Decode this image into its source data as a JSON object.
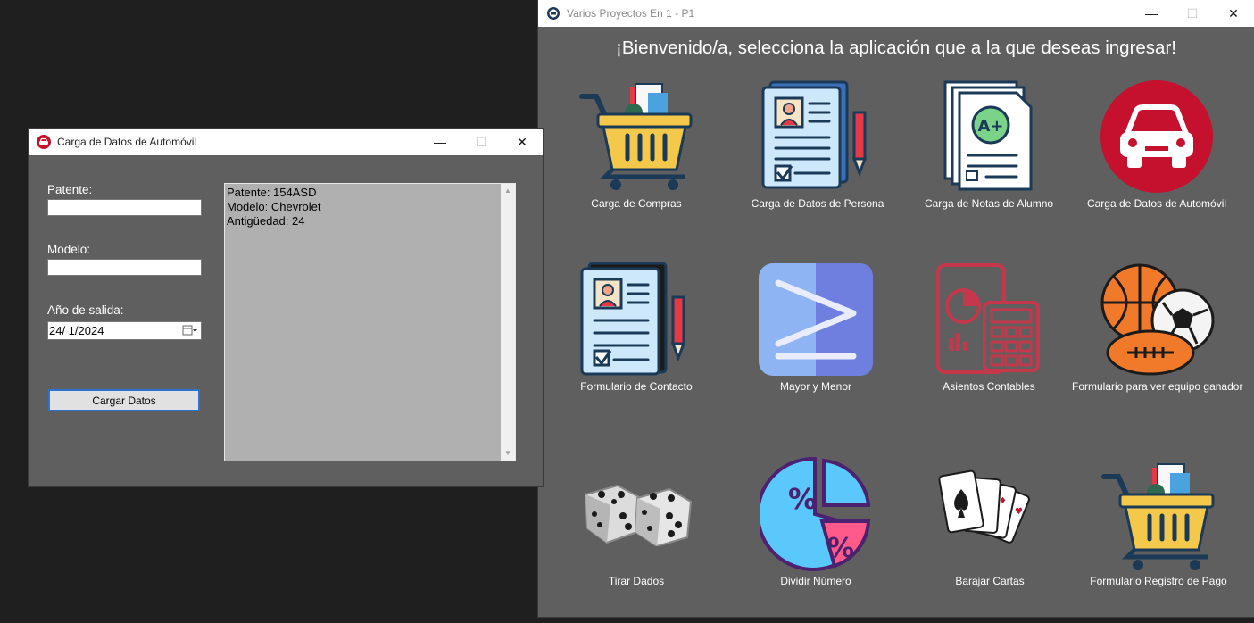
{
  "main_window": {
    "title": "Varios Proyectos En 1 - P1",
    "welcome": "¡Bienvenido/a, selecciona la aplicación que a la que deseas ingresar!",
    "controls": {
      "minimize": "—",
      "maximize": "☐",
      "close": "✕"
    },
    "apps": [
      {
        "label": "Carga de Compras",
        "icon": "shopping-cart-icon"
      },
      {
        "label": "Carga de Datos de Persona",
        "icon": "person-document-icon"
      },
      {
        "label": "Carga de Notas de Alumno",
        "icon": "grade-document-icon"
      },
      {
        "label": "Carga de Datos de Automóvil",
        "icon": "car-icon"
      },
      {
        "label": "Formulario de Contacto",
        "icon": "contact-form-icon"
      },
      {
        "label": "Mayor y Menor",
        "icon": "greater-equal-icon"
      },
      {
        "label": "Asientos Contables",
        "icon": "calculator-icon"
      },
      {
        "label": "Formulario para ver equipo ganador",
        "icon": "sports-balls-icon"
      },
      {
        "label": "Tirar Dados",
        "icon": "dice-icon"
      },
      {
        "label": "Dividir Número",
        "icon": "percent-pie-icon"
      },
      {
        "label": "Barajar Cartas",
        "icon": "playing-cards-icon"
      },
      {
        "label": "Formulario Registro de Pago",
        "icon": "shopping-cart-icon"
      }
    ]
  },
  "car_window": {
    "title": "Carga de Datos de Automóvil",
    "controls": {
      "minimize": "—",
      "maximize": "☐",
      "close": "✕"
    },
    "patente_label": "Patente:",
    "patente_value": "",
    "modelo_label": "Modelo:",
    "modelo_value": "",
    "anio_label": "Año de salida:",
    "anio_value": "24/  1/2024",
    "submit_label": "Cargar Datos",
    "output_lines": [
      "Patente: 154ASD",
      "Modelo: Chevrolet",
      "Antigüedad: 24"
    ]
  },
  "colors": {
    "background": "#1f1f1f",
    "window": "#5f5f5f",
    "accent": "#2a74d0",
    "car_red": "#c5102e"
  }
}
